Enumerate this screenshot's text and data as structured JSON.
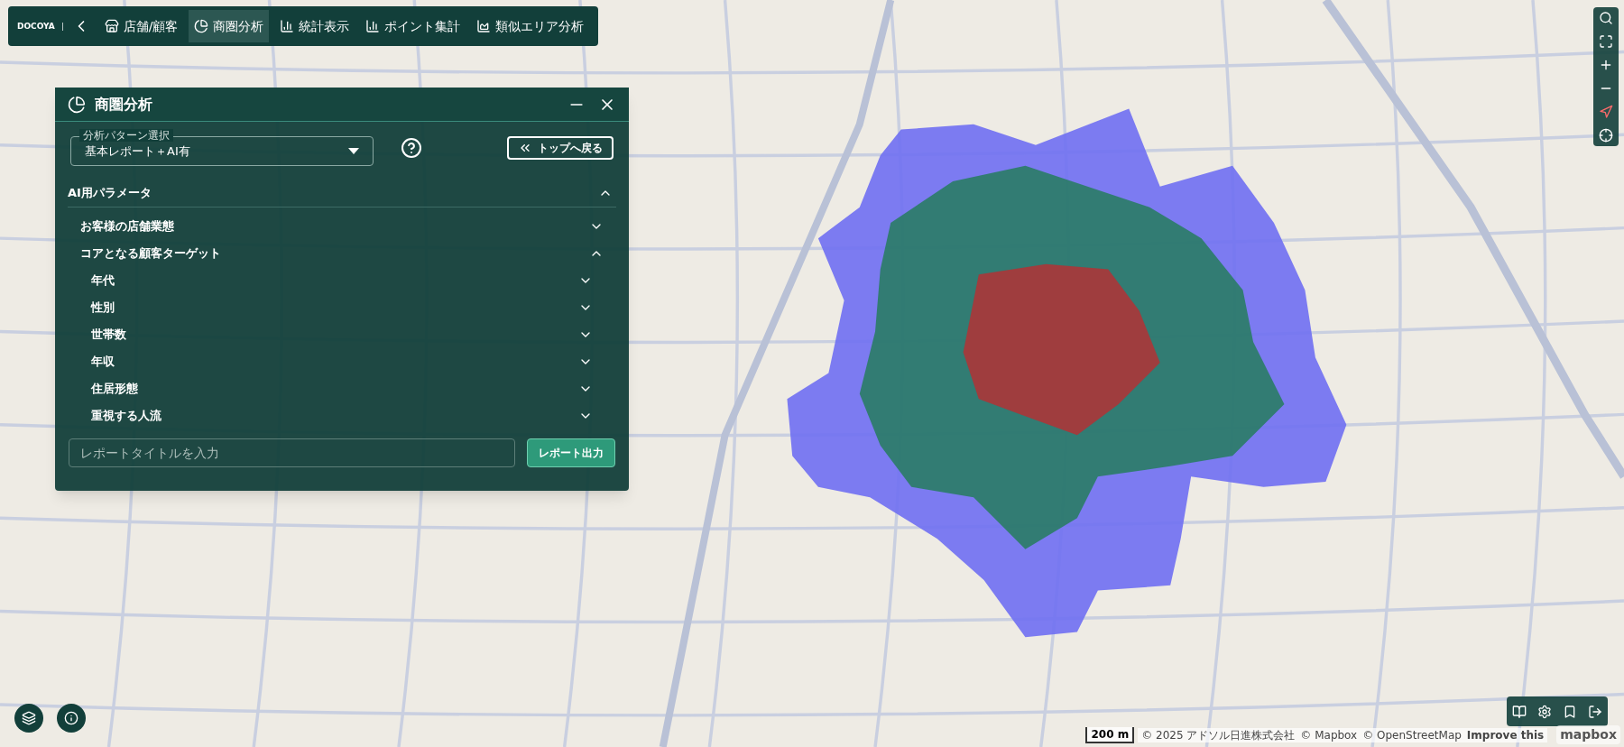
{
  "toolbar": {
    "logo": "DOCOYA",
    "tabs": [
      {
        "label": "店舗/顧客",
        "selected": false
      },
      {
        "label": "商圏分析",
        "selected": true
      },
      {
        "label": "統計表示",
        "selected": false
      },
      {
        "label": "ポイント集計",
        "selected": false
      },
      {
        "label": "類似エリア分析",
        "selected": false
      }
    ]
  },
  "panel": {
    "title": "商圏分析",
    "pattern_select": {
      "label": "分析パターン選択",
      "value": "基本レポート＋AI有"
    },
    "back_button": "トップへ戻る",
    "section": {
      "title": "AI用パラメータ",
      "expanded": true,
      "items": [
        {
          "label": "お客様の店舗業態",
          "expanded": false
        },
        {
          "label": "コアとなる顧客ターゲット",
          "expanded": true,
          "children": [
            {
              "label": "年代",
              "expanded": false
            },
            {
              "label": "性別",
              "expanded": false
            },
            {
              "label": "世帯数",
              "expanded": false
            },
            {
              "label": "年収",
              "expanded": false
            },
            {
              "label": "住居形態",
              "expanded": false
            },
            {
              "label": "重視する人流",
              "expanded": false
            }
          ]
        }
      ]
    },
    "report_title": {
      "placeholder": "レポートタイトルを入力"
    },
    "report_button": "レポート出力"
  },
  "map": {
    "scale": "200 m",
    "attribution": [
      "© 2025 アドソル日進株式会社",
      "© Mapbox",
      "© OpenStreetMap",
      "Improve this"
    ],
    "logo": "mapbox"
  }
}
